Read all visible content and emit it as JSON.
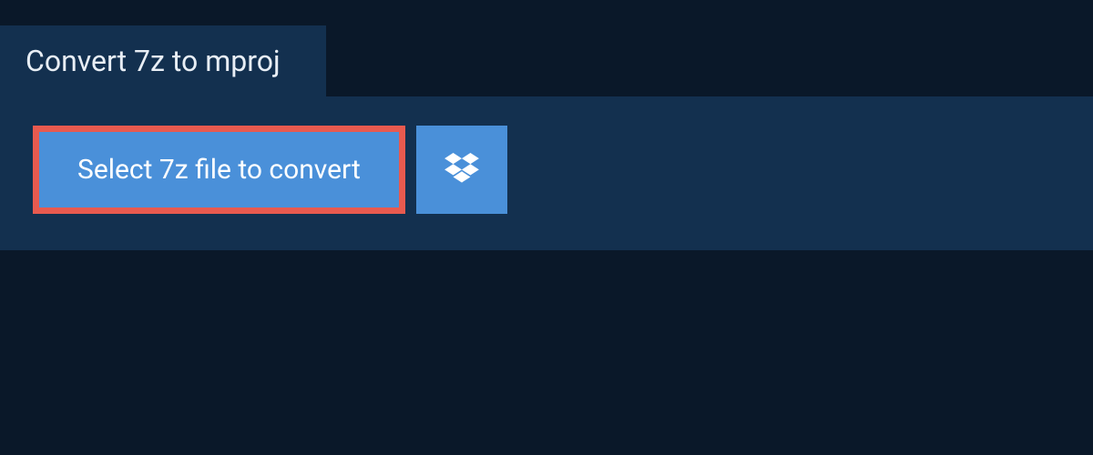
{
  "header": {
    "title": "Convert 7z to mproj"
  },
  "actions": {
    "select_file_label": "Select 7z file to convert"
  },
  "colors": {
    "background": "#0a1829",
    "panel": "#13304f",
    "button": "#4a90d9",
    "highlight_border": "#e85a4f",
    "text_light": "#e8eef5",
    "text_white": "#ffffff"
  }
}
